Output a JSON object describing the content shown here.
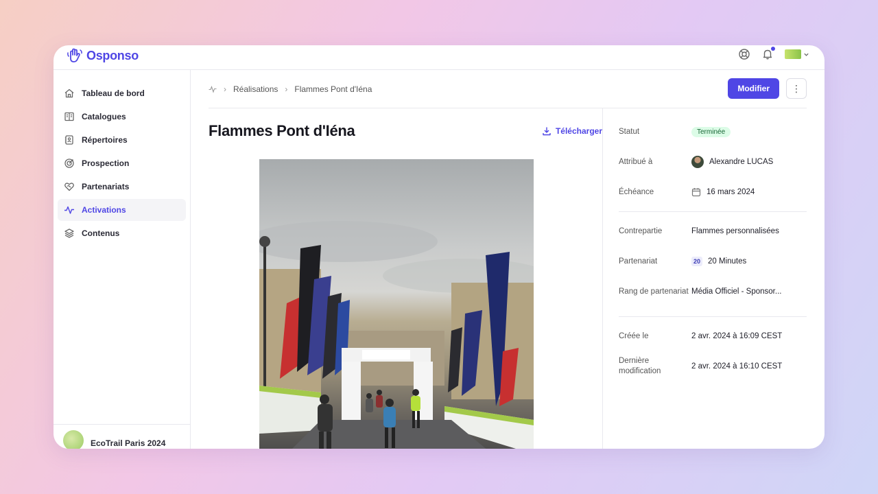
{
  "app": {
    "name": "Osponso"
  },
  "sidebar": {
    "items": [
      {
        "label": "Tableau de bord",
        "icon": "home-icon"
      },
      {
        "label": "Catalogues",
        "icon": "book-icon"
      },
      {
        "label": "Répertoires",
        "icon": "address-book-icon"
      },
      {
        "label": "Prospection",
        "icon": "target-icon"
      },
      {
        "label": "Partenariats",
        "icon": "handshake-heart-icon"
      },
      {
        "label": "Activations",
        "icon": "activity-icon",
        "active": true
      },
      {
        "label": "Contenus",
        "icon": "layers-icon"
      }
    ],
    "event": {
      "name": "EcoTrail Paris 2024"
    }
  },
  "breadcrumb": {
    "section": "Réalisations",
    "current": "Flammes Pont d'Iéna"
  },
  "actions": {
    "edit_label": "Modifier",
    "more_label": "⋮"
  },
  "activation": {
    "title": "Flammes Pont d'Iéna",
    "download_label": "Télécharger"
  },
  "details": {
    "status": {
      "label": "Statut",
      "value": "Terminée"
    },
    "assigned": {
      "label": "Attribué à",
      "value": "Alexandre LUCAS"
    },
    "due": {
      "label": "Échéance",
      "value": "16 mars 2024"
    },
    "counterpart": {
      "label": "Contrepartie",
      "value": "Flammes personnalisées"
    },
    "partnership": {
      "label": "Partenariat",
      "value": "20 Minutes",
      "logo_text": "20"
    },
    "rank": {
      "label": "Rang de partenariat",
      "value": "Média Officiel - Sponsor..."
    },
    "created": {
      "label": "Créée le",
      "value": "2 avr. 2024 à 16:09 CEST"
    },
    "modified": {
      "label": "Dernière modification",
      "value": "2 avr. 2024 à 16:10 CEST"
    }
  },
  "colors": {
    "accent": "#4f46e5",
    "status_bg": "#dcfce7",
    "status_text": "#166534"
  }
}
